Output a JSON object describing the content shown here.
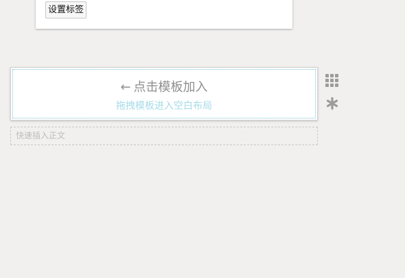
{
  "top_card": {
    "set_tags_label": "设置标签"
  },
  "template_area": {
    "arrow": "←",
    "click_hint": "点击模板加入",
    "drag_hint": "拖拽模板进入空白布局"
  },
  "quick_insert": {
    "placeholder": "快速插入正文"
  },
  "side_tools": {
    "grid_icon": "grid-icon",
    "asterisk_icon": "asterisk-icon"
  },
  "colors": {
    "background": "#f1f0ef",
    "dotted_border": "#79c3d4",
    "drag_hint_text": "#a6dbe8",
    "icon_gray": "#9b9b9b"
  }
}
